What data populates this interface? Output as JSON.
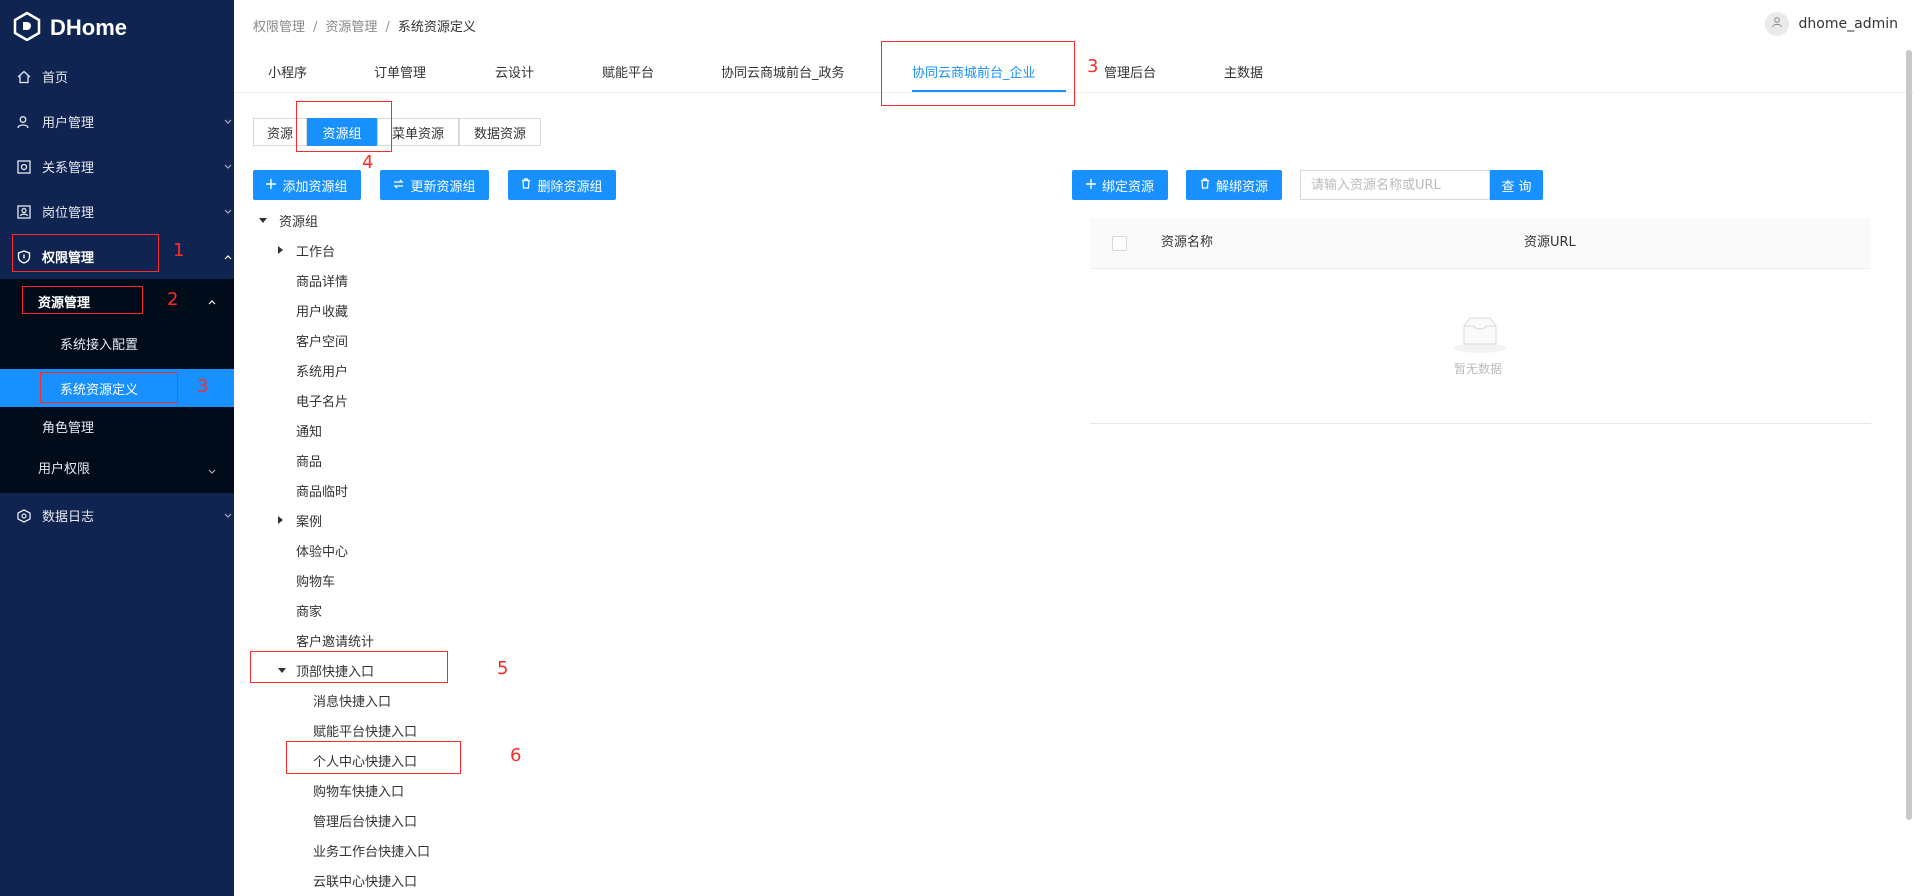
{
  "app": {
    "brand": "DHome"
  },
  "sidebar": {
    "items": [
      {
        "label": "首页",
        "icon": "home-icon"
      },
      {
        "label": "用户管理",
        "icon": "users-icon"
      },
      {
        "label": "关系管理",
        "icon": "relation-icon"
      },
      {
        "label": "岗位管理",
        "icon": "position-icon"
      },
      {
        "label": "权限管理",
        "icon": "shield-icon"
      },
      {
        "label": "资源管理"
      },
      {
        "label": "系统接入配置"
      },
      {
        "label": "系统资源定义"
      },
      {
        "label": "角色管理"
      },
      {
        "label": "用户权限"
      },
      {
        "label": "数据日志",
        "icon": "log-icon"
      }
    ]
  },
  "breadcrumb": [
    "权限管理",
    "资源管理",
    "系统资源定义"
  ],
  "user": {
    "name": "dhome_admin"
  },
  "tabs": [
    "小程序",
    "订单管理",
    "云设计",
    "赋能平台",
    "协同云商城前台_政务",
    "协同云商城前台_企业",
    "管理后台",
    "主数据"
  ],
  "segments": [
    "资源",
    "资源组",
    "菜单资源",
    "数据资源"
  ],
  "actions": {
    "add_group": "添加资源组",
    "update_group": "更新资源组",
    "delete_group": "删除资源组",
    "bind_resource": "绑定资源",
    "unbind_resource": "解绑资源",
    "search_placeholder": "请输入资源名称或URL",
    "search_button": "查 询"
  },
  "tree": [
    "资源组",
    "工作台",
    "商品详情",
    "用户收藏",
    "客户空间",
    "系统用户",
    "电子名片",
    "通知",
    "商品",
    "商品临时",
    "案例",
    "体验中心",
    "购物车",
    "商家",
    "客户邀请统计",
    "顶部快捷入口",
    "消息快捷入口",
    "赋能平台快捷入口",
    "个人中心快捷入口",
    "购物车快捷入口",
    "管理后台快捷入口",
    "业务工作台快捷入口",
    "云联中心快捷入口"
  ],
  "table": {
    "columns": [
      "资源名称",
      "资源URL"
    ],
    "empty_text": "暂无数据"
  },
  "annotations": [
    "1",
    "2",
    "3",
    "3",
    "4",
    "5",
    "6"
  ],
  "colors": {
    "sidebar_bg": "#0f2450",
    "submenu_bg": "#000c1a",
    "accent": "#1890ff",
    "annotation": "#ff2a2a"
  }
}
